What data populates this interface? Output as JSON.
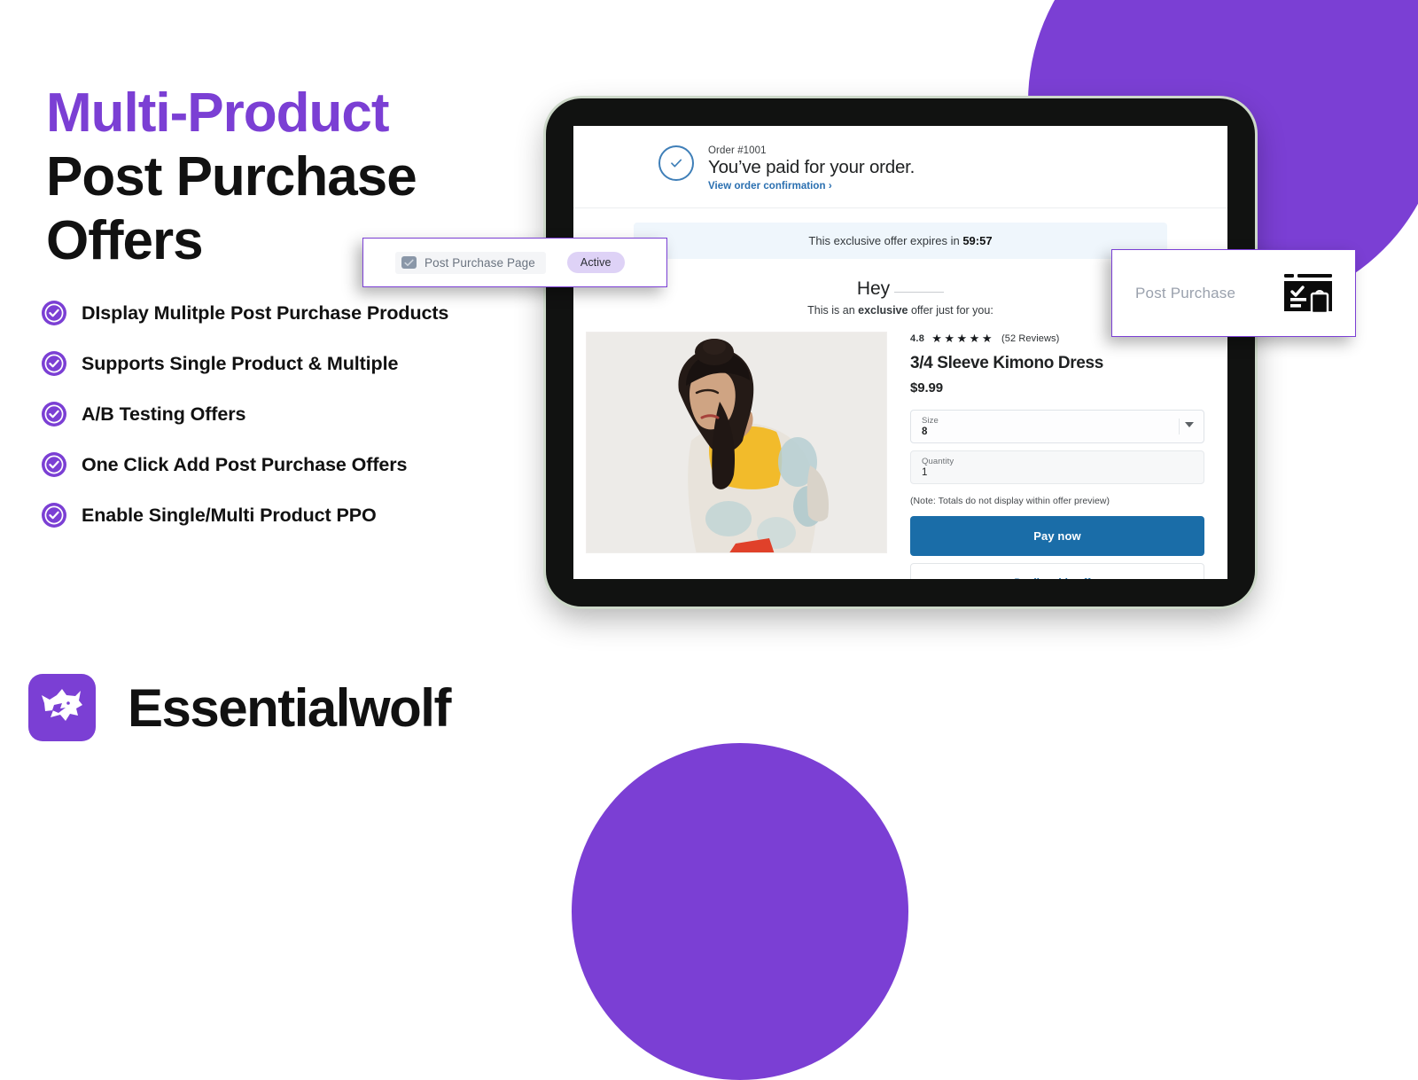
{
  "theme": {
    "brand_purple": "#7B3FD4",
    "accent_blue": "#1A6DA8",
    "badge_bg": "#ded2f6",
    "timer_bg": "#eff6fc"
  },
  "hero": {
    "headline_accent": "Multi-Product",
    "headline_line2": "Post Purchase",
    "headline_line3": "Offers",
    "features": [
      {
        "icon": "check-circle-icon",
        "label": "DIsplay Mulitple Post Purchase Products"
      },
      {
        "icon": "check-circle-icon",
        "label": "Supports Single Product & Multiple"
      },
      {
        "icon": "check-circle-icon",
        "label": "A/B Testing Offers"
      },
      {
        "icon": "check-circle-icon",
        "label": "One Click Add Post Purchase Offers"
      },
      {
        "icon": "check-circle-icon",
        "label": "Enable Single/Multi Product PPO"
      }
    ]
  },
  "brand": {
    "logo_icon": "wolf-head-icon",
    "name": "Essentialwolf"
  },
  "cards": {
    "left": {
      "checkbox_icon": "checkbox-checked-icon",
      "label": "Post Purchase Page",
      "badge": "Active"
    },
    "right": {
      "label": "Post Purchase",
      "icon": "post-purchase-window-icon"
    }
  },
  "checkout": {
    "status_icon": "check-circle-outline-icon",
    "order_number": "Order #1001",
    "paid_message": "You’ve paid for your order.",
    "confirmation_link": "View order confirmation ›",
    "timer_prefix": "This exclusive offer expires in",
    "timer_value": "59:57",
    "greeting": "Hey",
    "offer_line_pre": "This is an",
    "offer_line_bold": "exclusive",
    "offer_line_post": "offer just for you:",
    "product": {
      "photo_alt": "model-wearing-kimono-dress",
      "rating": "4.8",
      "stars": "★★★★★",
      "reviews": "(52 Reviews)",
      "title": "3/4 Sleeve Kimono Dress",
      "price": "$9.99",
      "fields": [
        {
          "label": "Size",
          "value": "8",
          "has_caret": true
        },
        {
          "label": "Quantity",
          "value": "1",
          "has_caret": false
        }
      ],
      "note": "(Note: Totals do not display within offer preview)",
      "pay_button": "Pay now",
      "decline_button": "Decline this offer"
    }
  }
}
